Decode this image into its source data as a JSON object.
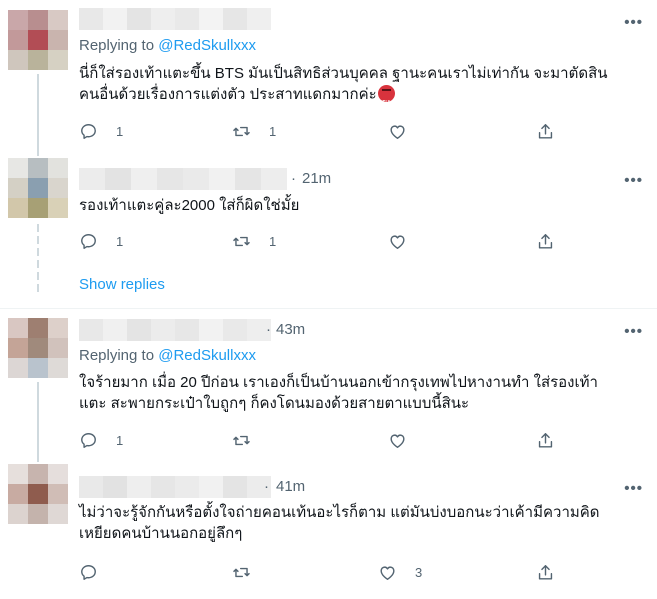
{
  "tweets": [
    {
      "id": "t1",
      "time": "",
      "replying_prefix": "Replying to",
      "replying_handle": "@RedSkullxxx",
      "text_lines": [
        "นี่ก็ใส่รองเท้าแตะขึ้น BTS มันเป็นสิทธิส่วนบุคคล ฐานะคนเราไม่เท่ากัน จะมาตัดสิน",
        "คนอื่นด้วยเรื่องการแต่งตัว ประสาทแดกมากค่ะ"
      ],
      "emoji": "cursing-face-emoji",
      "counts": {
        "reply": "1",
        "retweet": "1",
        "like": "",
        "share": ""
      }
    },
    {
      "id": "t2",
      "time": "21m",
      "text_lines": [
        "รองเท้าแตะคู่ละ2000 ใส่ก็ผิดใช่มั้ย"
      ],
      "counts": {
        "reply": "1",
        "retweet": "1",
        "like": "",
        "share": ""
      }
    },
    {
      "id": "t3",
      "time": "43m",
      "replying_prefix": "Replying to",
      "replying_handle": "@RedSkullxxx",
      "text_lines": [
        "ใจร้ายมาก เมื่อ 20 ปีก่อน เราเองก็เป็นบ้านนอกเข้ากรุงเทพไปหางานทำ ใส่รองเท้า",
        "แตะ สะพายกระเป๋าใบถูกๆ ก็คงโดนมองด้วยสายตาแบบนี้สินะ"
      ],
      "counts": {
        "reply": "1",
        "retweet": "",
        "like": "",
        "share": ""
      }
    },
    {
      "id": "t4",
      "time": "41m",
      "text_lines": [
        "ไม่ว่าจะรู้จักกันหรือตั้งใจถ่ายคอนเท้นอะไรก็ตาม แต่มันบ่งบอกนะว่าเค้ามีความคิด",
        "เหยียดคนบ้านนอกอยู่ลึกๆ"
      ],
      "counts": {
        "reply": "",
        "retweet": "",
        "like": "3",
        "share": ""
      }
    }
  ],
  "show_replies": "Show replies",
  "separator": "·",
  "more_glyph": "•••",
  "colors": {
    "accent": "#1d9bf0",
    "secondary_text": "#536471",
    "primary_text": "#0f1419",
    "thread_line": "#cfd9de"
  }
}
